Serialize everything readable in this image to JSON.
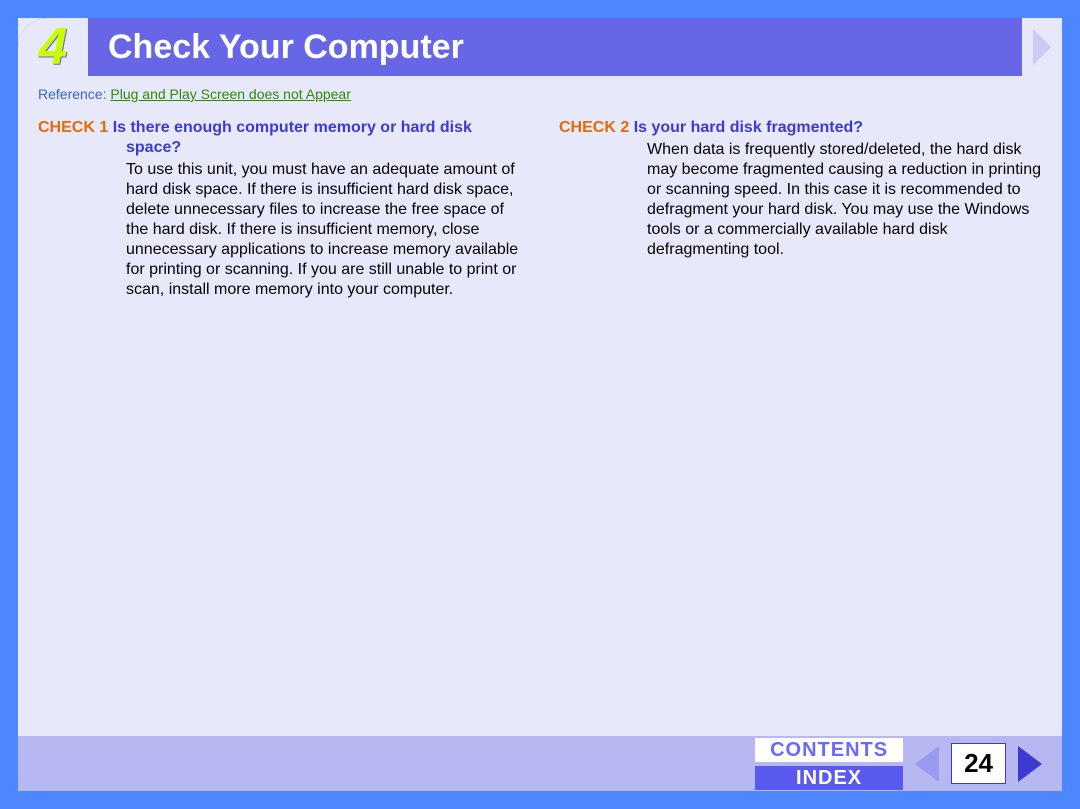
{
  "header": {
    "section_number": "4",
    "title": "Check Your Computer"
  },
  "reference": {
    "label": "Reference:",
    "link_text": "Plug and Play Screen does not Appear"
  },
  "checks": [
    {
      "label": "CHECK 1",
      "question": "Is there enough computer memory or hard disk space?",
      "body": "To use this unit, you must have an adequate amount of hard disk space. If there is insufficient hard disk space, delete unnecessary files to increase the free space of the hard disk. If there is insufficient memory, close unnecessary applications to increase memory available for printing or scanning. If you are still unable to print or scan, install more memory into your computer."
    },
    {
      "label": "CHECK 2",
      "question": "Is your hard disk fragmented?",
      "body": "When data is frequently stored/deleted, the hard disk may become fragmented causing a reduction in printing or scanning speed. In this case it is recommended to defragment your hard disk. You may use the Windows tools or a commercially available hard disk defragmenting tool."
    }
  ],
  "footer": {
    "contents_label": "CONTENTS",
    "index_label": "INDEX",
    "page_number": "24"
  }
}
